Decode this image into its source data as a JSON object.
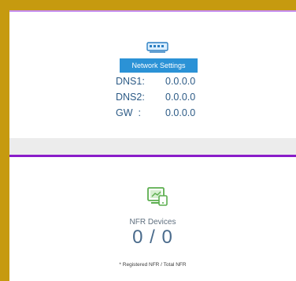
{
  "network": {
    "icon": "network-switch-icon",
    "title": "Network Settings",
    "rows": [
      {
        "key": "DNS1:",
        "value": "0.0.0.0"
      },
      {
        "key": "DNS2:",
        "value": "0.0.0.0"
      },
      {
        "key": "GW  :",
        "value": "0.0.0.0"
      }
    ]
  },
  "nfr": {
    "icon": "nfr-device-icon",
    "label": "NFR Devices",
    "count": "0 / 0",
    "note": "* Registered NFR / Total NFR"
  },
  "colors": {
    "frame": "#c69a0f",
    "accent_blue": "#2b92d6",
    "divider_purple": "#8a1cc9",
    "icon_green": "#5cae4f"
  }
}
